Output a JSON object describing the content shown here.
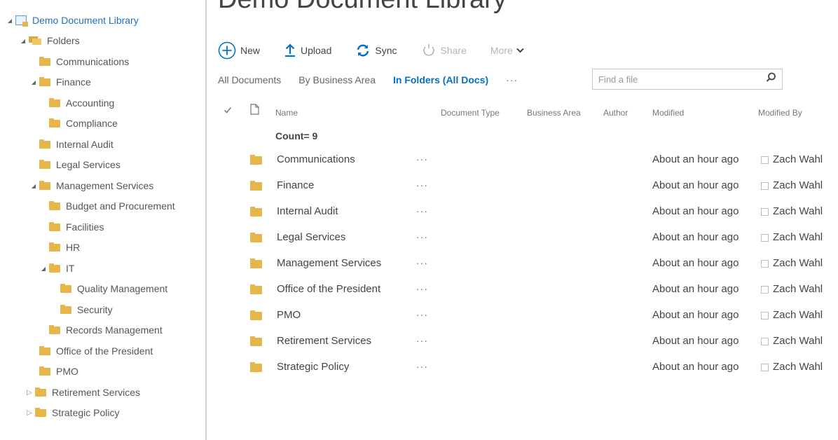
{
  "tree": {
    "items": [
      {
        "label": "Demo Document Library"
      },
      {
        "label": "Folders"
      },
      {
        "label": "Communications"
      },
      {
        "label": "Finance"
      },
      {
        "label": "Accounting"
      },
      {
        "label": "Compliance"
      },
      {
        "label": "Internal Audit"
      },
      {
        "label": "Legal Services"
      },
      {
        "label": "Management Services"
      },
      {
        "label": "Budget and Procurement"
      },
      {
        "label": "Facilities"
      },
      {
        "label": "HR"
      },
      {
        "label": "IT"
      },
      {
        "label": "Quality Management"
      },
      {
        "label": "Security"
      },
      {
        "label": "Records Management"
      },
      {
        "label": "Office of the President"
      },
      {
        "label": "PMO"
      },
      {
        "label": "Retirement Services"
      },
      {
        "label": "Strategic Policy"
      }
    ]
  },
  "page": {
    "title": "Demo Document Library"
  },
  "commands": {
    "new": "New",
    "upload": "Upload",
    "sync": "Sync",
    "share": "Share",
    "more": "More"
  },
  "views": {
    "all_documents": "All Documents",
    "by_business_area": "By Business Area",
    "in_folders": "In Folders (All Docs)",
    "more": "···"
  },
  "search": {
    "placeholder": "Find a file"
  },
  "columns": {
    "name": "Name",
    "document_type": "Document Type",
    "business_area": "Business Area",
    "author": "Author",
    "modified": "Modified",
    "modified_by": "Modified By"
  },
  "list": {
    "count_label": "Count= 9",
    "ellipsis": "···",
    "rows": [
      {
        "name": "Communications",
        "modified": "About an hour ago",
        "modified_by": "Zach Wahl"
      },
      {
        "name": "Finance",
        "modified": "About an hour ago",
        "modified_by": "Zach Wahl"
      },
      {
        "name": "Internal Audit",
        "modified": "About an hour ago",
        "modified_by": "Zach Wahl"
      },
      {
        "name": "Legal Services",
        "modified": "About an hour ago",
        "modified_by": "Zach Wahl"
      },
      {
        "name": "Management Services",
        "modified": "About an hour ago",
        "modified_by": "Zach Wahl"
      },
      {
        "name": "Office of the President",
        "modified": "About an hour ago",
        "modified_by": "Zach Wahl"
      },
      {
        "name": "PMO",
        "modified": "About an hour ago",
        "modified_by": "Zach Wahl"
      },
      {
        "name": "Retirement Services",
        "modified": "About an hour ago",
        "modified_by": "Zach Wahl"
      },
      {
        "name": "Strategic Policy",
        "modified": "About an hour ago",
        "modified_by": "Zach Wahl"
      }
    ]
  },
  "colors": {
    "accent": "#0072c6",
    "folder": "#e5b74b",
    "text": "#444444"
  }
}
